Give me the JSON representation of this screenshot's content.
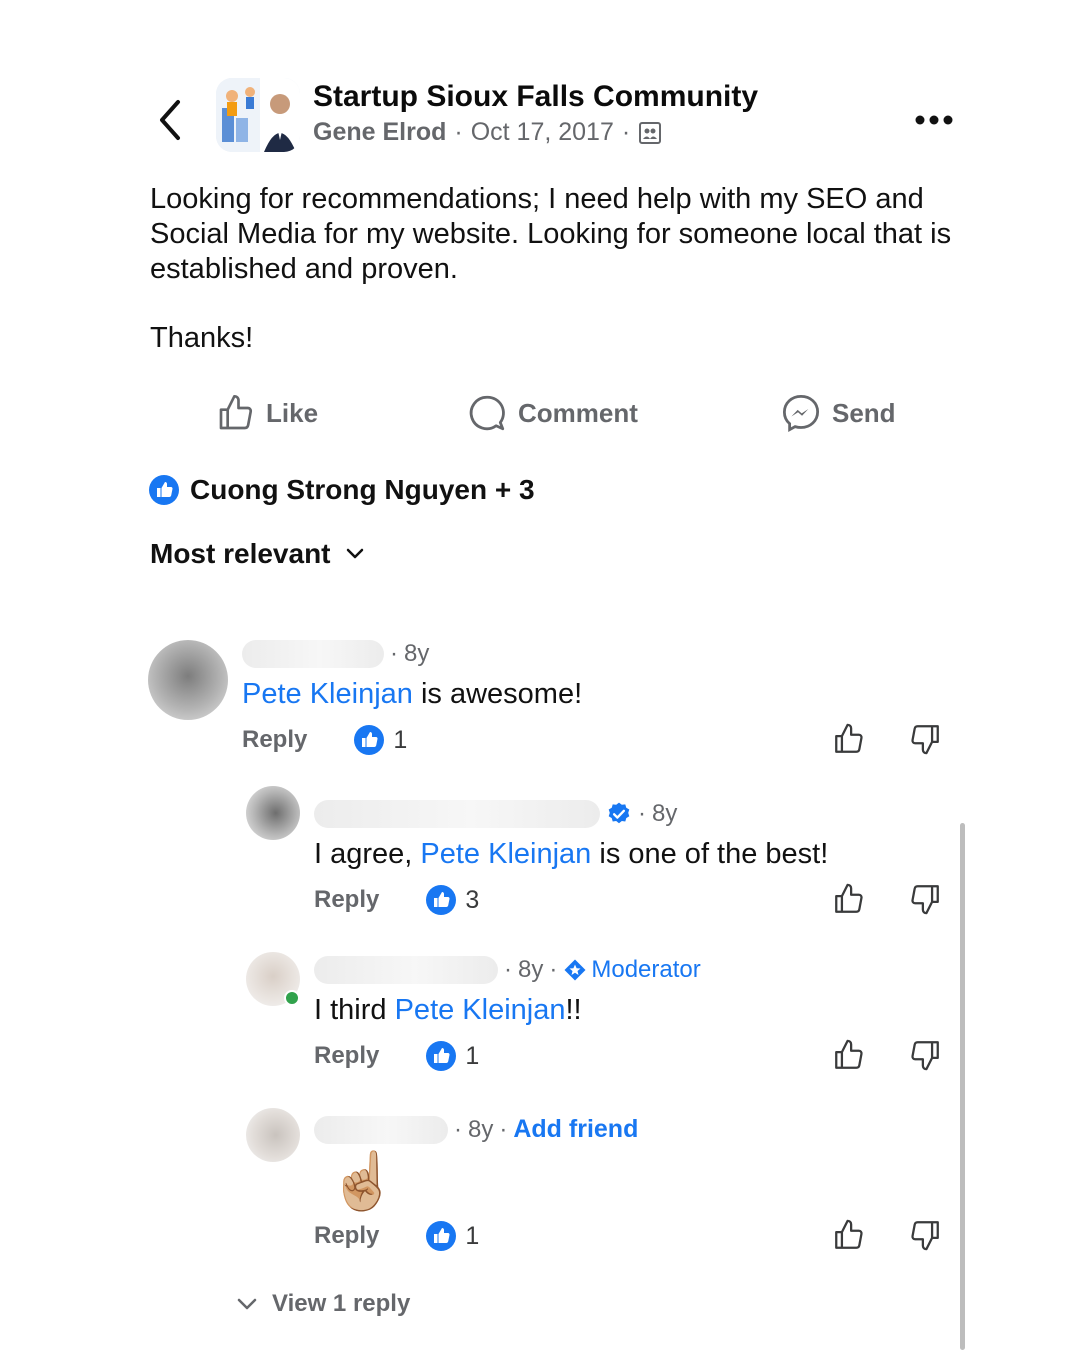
{
  "post": {
    "group_name": "Startup Sioux Falls Community",
    "author": "Gene Elrod",
    "date": "Oct 17, 2017",
    "separator": "·",
    "body": "Looking for recommendations; I need help with my SEO and Social Media for my website. Looking for someone local that is established and proven.",
    "thanks": "Thanks!"
  },
  "actions": {
    "like": "Like",
    "comment": "Comment",
    "send": "Send"
  },
  "reactions": {
    "summary": "Cuong Strong Nguyen + 3"
  },
  "sort": {
    "label": "Most relevant"
  },
  "comments": [
    {
      "age": "8y",
      "text_before": "",
      "mention": "Pete Kleinjan",
      "text_after": " is awesome!",
      "reply_label": "Reply",
      "likes": "1"
    },
    {
      "age": "8y",
      "text_before": "I agree, ",
      "mention": "Pete Kleinjan",
      "text_after": " is one of the best!",
      "reply_label": "Reply",
      "likes": "3"
    },
    {
      "age": "8y",
      "badge": "Moderator",
      "text_before": "I third ",
      "mention": "Pete Kleinjan",
      "text_after": "!!",
      "reply_label": "Reply",
      "likes": "1"
    },
    {
      "age": "8y",
      "add_friend": "Add friend",
      "emoji": "☝🏼",
      "reply_label": "Reply",
      "likes": "1"
    }
  ],
  "view_replies": "View 1 reply",
  "colors": {
    "accent": "#1877f2",
    "muted": "#65676b",
    "text": "#111111"
  }
}
